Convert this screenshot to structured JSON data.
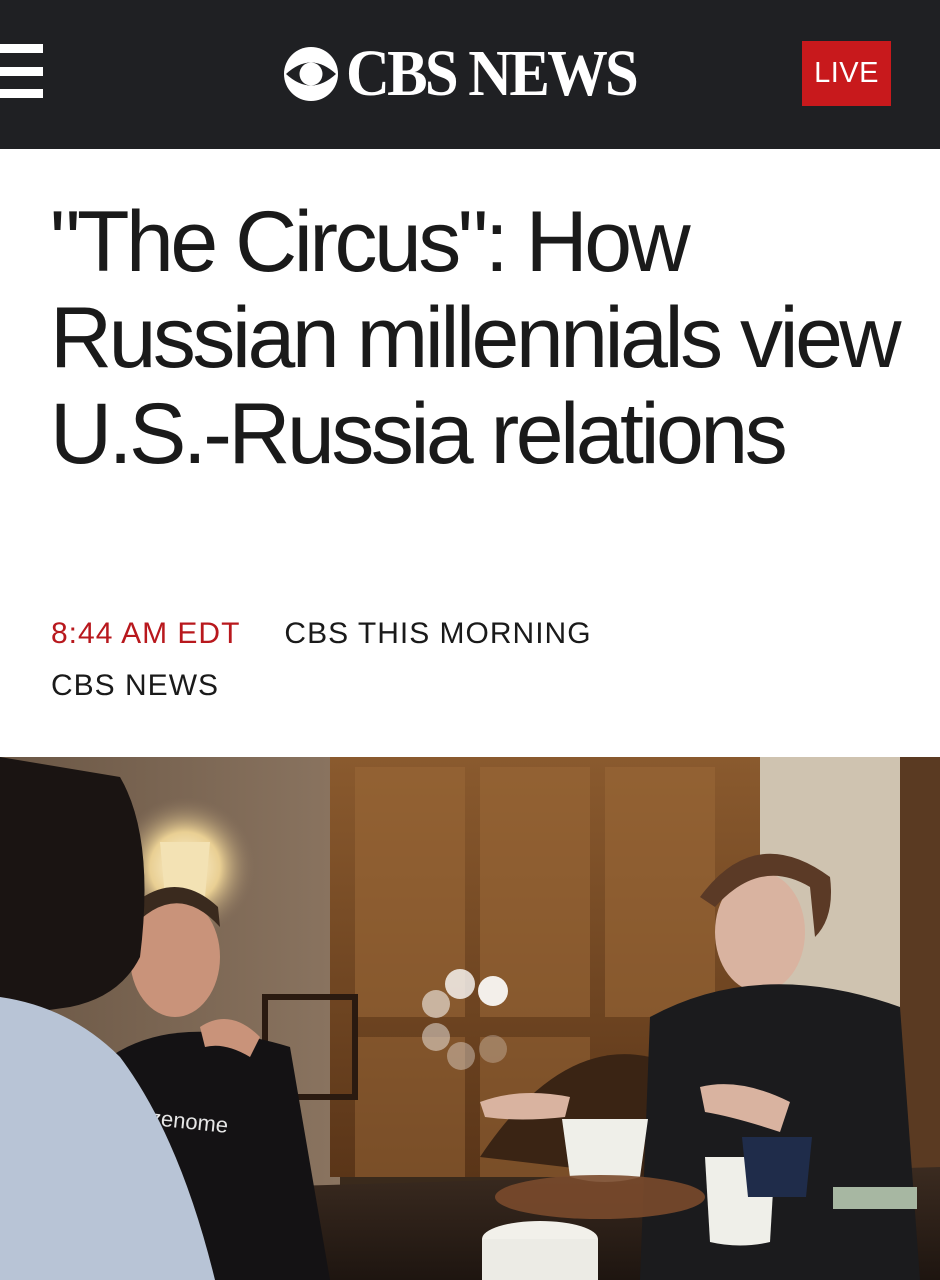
{
  "header": {
    "menu_icon": "hamburger-menu-icon",
    "logo_text": "CBS NEWS",
    "logo_icon": "cbs-eye-icon",
    "live_label": "LIVE",
    "background_color": "#1f2023",
    "live_color": "#c8191c"
  },
  "article": {
    "headline": "\"The Circus\": How Russian millennials view U.S.-Russia relations",
    "time": "8:44 AM EDT",
    "show": "CBS THIS MORNING",
    "source": "CBS NEWS",
    "time_color": "#b8181d"
  },
  "media": {
    "shirt_text": "zenome",
    "loading_icon": "loading-spinner-icon"
  }
}
